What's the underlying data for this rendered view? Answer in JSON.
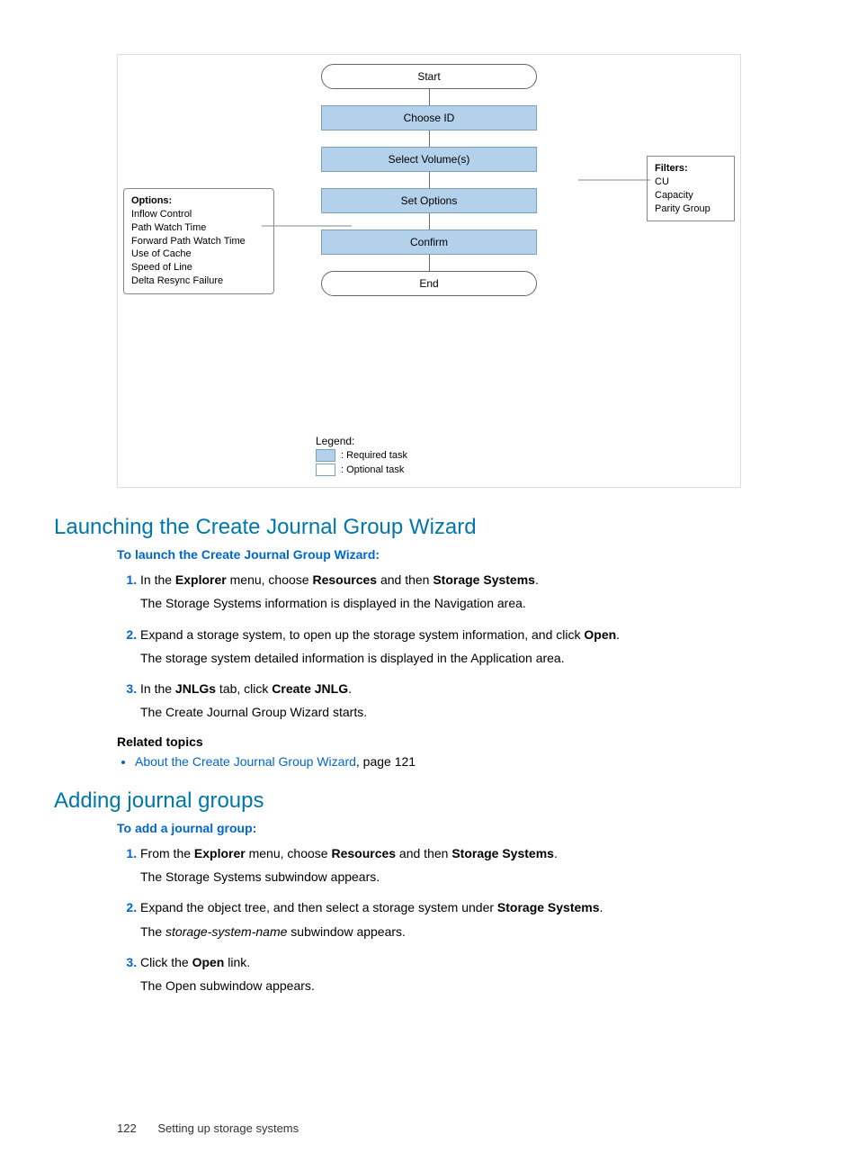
{
  "diagram": {
    "start": "Start",
    "end": "End",
    "steps": [
      "Choose ID",
      "Select Volume(s)",
      "Set Options",
      "Confirm"
    ],
    "options": {
      "title": "Options:",
      "items": [
        "Inflow Control",
        "Path Watch Time",
        "Forward Path Watch Time",
        "Use of Cache",
        "Speed of Line",
        "Delta Resync Failure"
      ]
    },
    "filters": {
      "title": "Filters:",
      "items": [
        "CU",
        "Capacity",
        "Parity Group"
      ]
    },
    "legend": {
      "title": "Legend:",
      "required": ": Required task",
      "optional": ": Optional task"
    }
  },
  "section1": {
    "heading": "Launching the Create Journal Group Wizard",
    "sub": "To launch the Create Journal Group Wizard:",
    "steps": [
      {
        "t1": "In the ",
        "b1": "Explorer",
        "t2": " menu, choose ",
        "b2": "Resources",
        "t3": " and then ",
        "b3": "Storage Systems",
        "t4": ".",
        "after": "The Storage Systems information is displayed in the Navigation area."
      },
      {
        "t1": "Expand a storage system, to open up the storage system information, and click ",
        "b1": "Open",
        "t2": ".",
        "after": "The storage system detailed information is displayed in the Application area."
      },
      {
        "t1": "In the ",
        "b1": "JNLGs",
        "t2": " tab, click ",
        "b2": "Create JNLG",
        "t3": ".",
        "after": "The Create Journal Group Wizard starts."
      }
    ],
    "related_h": "Related topics",
    "related_link": "About the Create Journal Group Wizard",
    "related_suffix": ", page 121"
  },
  "section2": {
    "heading": "Adding journal groups",
    "sub": "To add a journal group:",
    "steps": [
      {
        "t1": "From the ",
        "b1": "Explorer",
        "t2": " menu, choose ",
        "b2": "Resources",
        "t3": " and then ",
        "b3": "Storage Systems",
        "t4": ".",
        "after": "The Storage Systems subwindow appears."
      },
      {
        "t1": "Expand the object tree, and then select a storage system under ",
        "b1": "Storage Systems",
        "t2": ".",
        "after_pre": "The ",
        "after_i": "storage-system-name",
        "after_post": " subwindow appears."
      },
      {
        "t1": "Click the ",
        "b1": "Open",
        "t2": " link.",
        "after": "The Open subwindow appears."
      }
    ]
  },
  "footer": {
    "page": "122",
    "title": "Setting up storage systems"
  }
}
